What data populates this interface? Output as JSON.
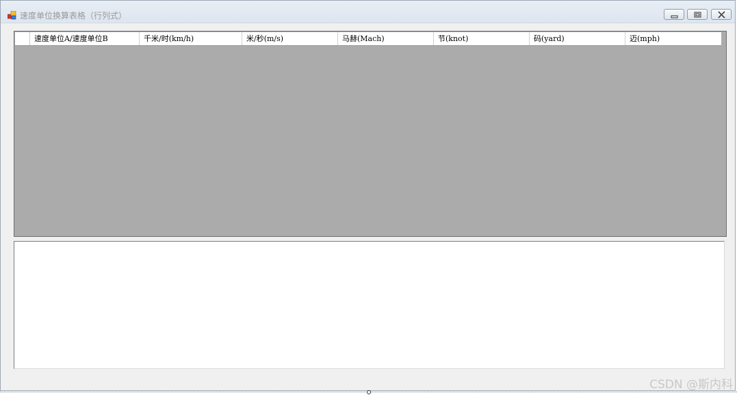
{
  "window": {
    "title": "速度单位换算表格（行列式）"
  },
  "grid": {
    "columns": [
      "速度单位A/速度单位B",
      "千米/时(km/h)",
      "米/秒(m/s)",
      "马赫(Mach)",
      "节(knot)",
      "码(yard)",
      "迈(mph)"
    ],
    "rows": []
  },
  "output": {
    "text": ""
  },
  "watermark": "CSDN @斯内科",
  "colors": {
    "grid_background": "#ababab",
    "window_background": "#f0f0f0",
    "title_text": "#9a9a9a"
  },
  "icons": {
    "app": "app-icon",
    "minimize": "minimize-icon",
    "maximize": "maximize-icon",
    "close": "close-icon"
  }
}
